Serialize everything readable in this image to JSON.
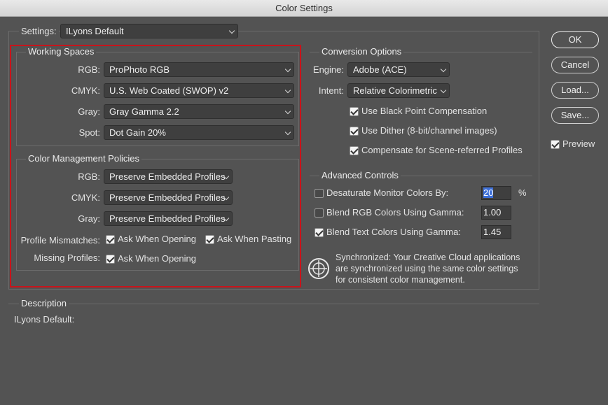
{
  "window": {
    "title": "Color Settings"
  },
  "settings": {
    "label": "Settings:",
    "value": "ILyons Default"
  },
  "working_spaces": {
    "title": "Working Spaces",
    "rgb": {
      "label": "RGB:",
      "value": "ProPhoto RGB"
    },
    "cmyk": {
      "label": "CMYK:",
      "value": "U.S. Web Coated (SWOP) v2"
    },
    "gray": {
      "label": "Gray:",
      "value": "Gray Gamma 2.2"
    },
    "spot": {
      "label": "Spot:",
      "value": "Dot Gain 20%"
    }
  },
  "policies": {
    "title": "Color Management Policies",
    "rgb": {
      "label": "RGB:",
      "value": "Preserve Embedded Profiles"
    },
    "cmyk": {
      "label": "CMYK:",
      "value": "Preserve Embedded Profiles"
    },
    "gray": {
      "label": "Gray:",
      "value": "Preserve Embedded Profiles"
    },
    "mismatch_label": "Profile Mismatches:",
    "ask_opening_label": "Ask When Opening",
    "ask_opening_checked": true,
    "ask_pasting_label": "Ask When Pasting",
    "ask_pasting_checked": true,
    "missing_label": "Missing Profiles:",
    "missing_ask_opening_label": "Ask When Opening",
    "missing_ask_opening_checked": true
  },
  "conversion": {
    "title": "Conversion Options",
    "engine": {
      "label": "Engine:",
      "value": "Adobe (ACE)"
    },
    "intent": {
      "label": "Intent:",
      "value": "Relative Colorimetric"
    },
    "black_point": {
      "label": "Use Black Point Compensation",
      "checked": true
    },
    "dither": {
      "label": "Use Dither (8-bit/channel images)",
      "checked": true
    },
    "scene": {
      "label": "Compensate for Scene-referred Profiles",
      "checked": true
    }
  },
  "advanced": {
    "title": "Advanced Controls",
    "desaturate": {
      "label": "Desaturate Monitor Colors By:",
      "checked": false,
      "value": "20",
      "unit": "%"
    },
    "blend_rgb": {
      "label": "Blend RGB Colors Using Gamma:",
      "checked": false,
      "value": "1.00"
    },
    "blend_text": {
      "label": "Blend Text Colors Using Gamma:",
      "checked": true,
      "value": "1.45"
    }
  },
  "sync": {
    "line1": "Synchronized: Your Creative Cloud applications",
    "line2": "are synchronized using the same color settings",
    "line3": "for consistent color management."
  },
  "description": {
    "title": "Description",
    "text": "ILyons Default:"
  },
  "buttons": {
    "ok": "OK",
    "cancel": "Cancel",
    "load": "Load...",
    "save": "Save...",
    "preview": "Preview",
    "preview_checked": true
  },
  "colors": {
    "highlight": "#c8141b",
    "background": "#535353",
    "selection": "#3d6fd8"
  }
}
